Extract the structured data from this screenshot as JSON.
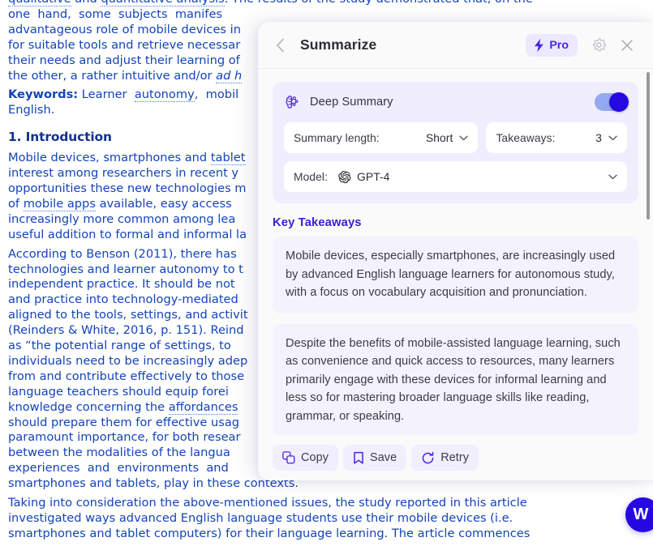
{
  "document": {
    "paragraphs": [
      "qualitative and quantitative analysis. The results of the study demonstrated that, on the one hand, some subjects manifes advantageous role of mobile devices in for suitable tools and retrieve necessar their needs and adjust their learning of the other, a rather intuitive and/or ad h"
    ],
    "abstract_lines": [
      "qualitative and quantitative analysis. The results of the study demonstrated that, on the",
      "one hand, some subjects manifes",
      "advantageous role of mobile devices in",
      "for suitable tools and retrieve necessar",
      "their needs and adjust their learning of",
      "the other, a rather intuitive and/or ad h"
    ],
    "keywords_label": "Keywords:",
    "keywords_text": "Learner autonomy, mobil",
    "keywords_line2": "English.",
    "section_heading": "1. Introduction",
    "intro_lines": [
      "Mobile devices, smartphones and tablet",
      "interest among researchers in recent y",
      "opportunities these new technologies m",
      "of mobile apps available, easy access",
      "increasingly more common among lea",
      "useful addition to formal and informal la"
    ],
    "benson_lines": [
      "According to Benson (2011), there has",
      "technologies and learner autonomy to t",
      "independent practice. It should be not",
      "and practice into technology-mediated",
      "aligned to the tools, settings, and activit",
      "(Reinders & White, 2016, p. 151). Reind",
      "as “the potential range of settings, to",
      "individuals need to be increasingly adep",
      "from and contribute effectively to those",
      "language teachers should equip forei",
      "knowledge concerning the affordances",
      "should prepare them for effective usag",
      "paramount importance, for both resear",
      "between the modalities of the langua",
      "experiences and environments and",
      "smartphones and tablets, play in these contexts."
    ],
    "closing_lines": [
      "Taking into consideration the above-mentioned issues, the study reported in this article",
      "investigated ways advanced English language students use their mobile devices (i.e.",
      "smartphones and tablet computers) for their language learning. The article commences"
    ]
  },
  "panel": {
    "header": {
      "back_icon": "chevron-left-icon",
      "title": "Summarize",
      "pro_label": "Pro",
      "pro_icon": "lightning-bolt-icon",
      "gear_icon": "gear-icon",
      "close_icon": "close-icon"
    },
    "settings": {
      "deep_summary_icon": "brain-icon",
      "deep_summary_label": "Deep Summary",
      "deep_summary_enabled": true,
      "summary_length_label": "Summary length:",
      "summary_length_value": "Short",
      "takeaways_label": "Takeaways:",
      "takeaways_value": "3",
      "model_label": "Model:",
      "model_icon": "openai-icon",
      "model_value": "GPT-4",
      "chevron_icon": "chevron-down-icon"
    },
    "takeaways": {
      "title": "Key Takeaways",
      "items": [
        "Mobile devices, especially smartphones, are increasingly used by advanced English language learners for autonomous study, with a focus on vocabulary acquisition and pronunciation.",
        "Despite the benefits of mobile-assisted language learning, such as convenience and quick access to resources, many learners primarily engage with these devices for informal learning and less so for mastering broader language skills like reading, grammar, or speaking."
      ]
    },
    "actions": [
      {
        "label": "Copy",
        "icon": "copy-icon"
      },
      {
        "label": "Save",
        "icon": "bookmark-icon"
      },
      {
        "label": "Retry",
        "icon": "refresh-icon"
      }
    ]
  },
  "floating_badge": {
    "label": "W",
    "name": "wordtune-badge"
  },
  "colors": {
    "accent": "#2509e0",
    "accent_soft": "#4b25df",
    "pill_bg": "#ece9fe",
    "card_bg": "#f4f3fd",
    "settings_bg": "#f0eefe",
    "doc_text": "#1443b8"
  }
}
